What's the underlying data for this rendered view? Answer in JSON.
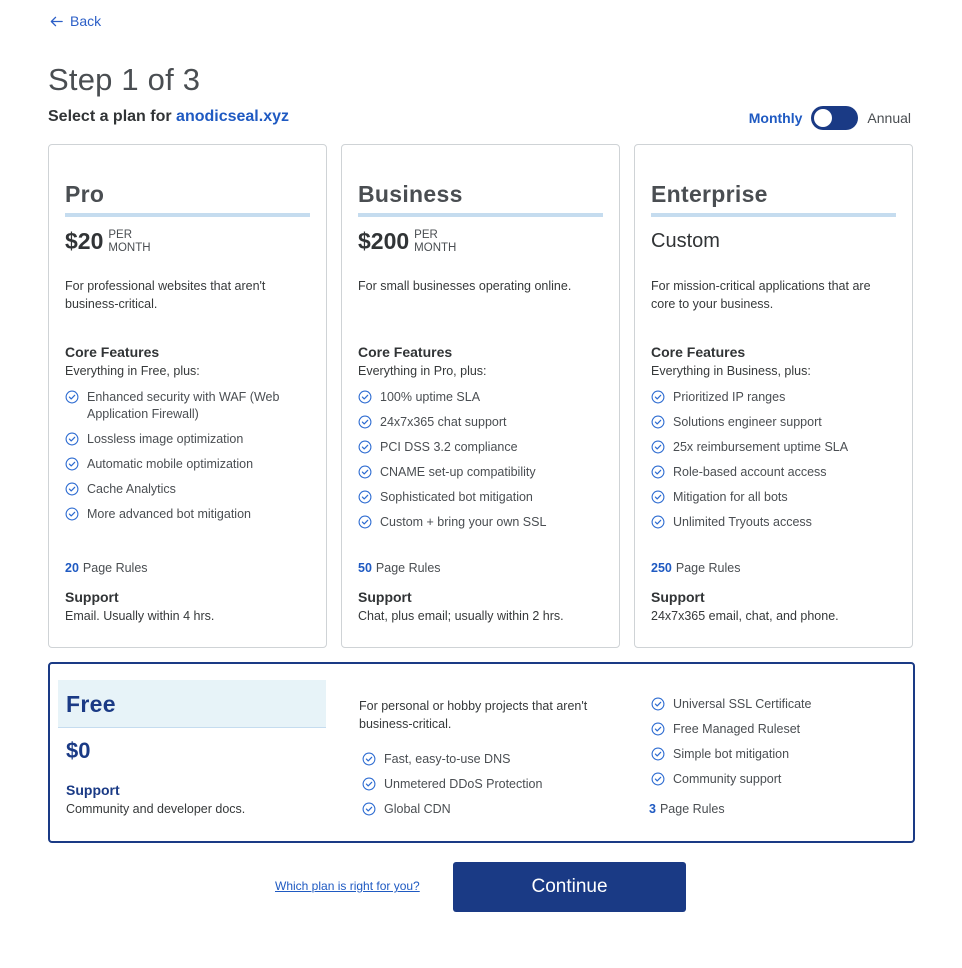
{
  "nav": {
    "back_label": "Back"
  },
  "header": {
    "step_title": "Step 1 of 3",
    "subtitle_prefix": "Select a plan for",
    "domain": "anodicseal.xyz"
  },
  "billing": {
    "monthly_label": "Monthly",
    "annual_label": "Annual",
    "selected": "Monthly"
  },
  "plans": [
    {
      "name": "Pro",
      "price": "$20",
      "per_line1": "PER",
      "per_line2": "MONTH",
      "description": "For professional websites that aren't business-critical.",
      "core_title": "Core Features",
      "core_sub": "Everything in Free, plus:",
      "features": [
        "Enhanced security with WAF (Web Application Firewall)",
        "Lossless image optimization",
        "Automatic mobile optimization",
        "Cache Analytics",
        "More advanced bot mitigation"
      ],
      "page_rules_count": "20",
      "page_rules_label": "Page Rules",
      "support_title": "Support",
      "support_text": "Email. Usually within 4 hrs."
    },
    {
      "name": "Business",
      "price": "$200",
      "per_line1": "PER",
      "per_line2": "MONTH",
      "description": "For small businesses operating online.",
      "core_title": "Core Features",
      "core_sub": "Everything in Pro, plus:",
      "features": [
        "100% uptime SLA",
        "24x7x365 chat support",
        "PCI DSS 3.2 compliance",
        "CNAME set-up compatibility",
        "Sophisticated bot mitigation",
        "Custom + bring your own SSL"
      ],
      "page_rules_count": "50",
      "page_rules_label": "Page Rules",
      "support_title": "Support",
      "support_text": "Chat, plus email; usually within 2 hrs."
    },
    {
      "name": "Enterprise",
      "price_custom": "Custom",
      "description": "For mission-critical applications that are core to your business.",
      "core_title": "Core Features",
      "core_sub": "Everything in Business, plus:",
      "features": [
        "Prioritized IP ranges",
        "Solutions engineer support",
        "25x reimbursement uptime SLA",
        "Role-based account access",
        "Mitigation for all bots",
        "Unlimited Tryouts access"
      ],
      "page_rules_count": "250",
      "page_rules_label": "Page Rules",
      "support_title": "Support",
      "support_text": "24x7x365 email, chat, and phone."
    }
  ],
  "free_plan": {
    "name": "Free",
    "price": "$0",
    "support_title": "Support",
    "support_text": "Community and developer docs.",
    "description": "For personal or hobby projects that aren't business-critical.",
    "features_col2": [
      "Fast, easy-to-use DNS",
      "Unmetered DDoS Protection",
      "Global CDN"
    ],
    "features_col3": [
      "Universal SSL Certificate",
      "Free Managed Ruleset",
      "Simple bot mitigation",
      "Community support"
    ],
    "page_rules_count": "3",
    "page_rules_label": "Page Rules"
  },
  "footer": {
    "help_link": "Which plan is right for you?",
    "continue_label": "Continue"
  },
  "colors": {
    "accent": "#1f5ac2",
    "primary_dark": "#1a3a85",
    "rule": "#c5dcef",
    "free_band": "#e7f3f8"
  },
  "icons": {
    "back": "arrow-left-icon",
    "feature": "check-circle-icon"
  }
}
